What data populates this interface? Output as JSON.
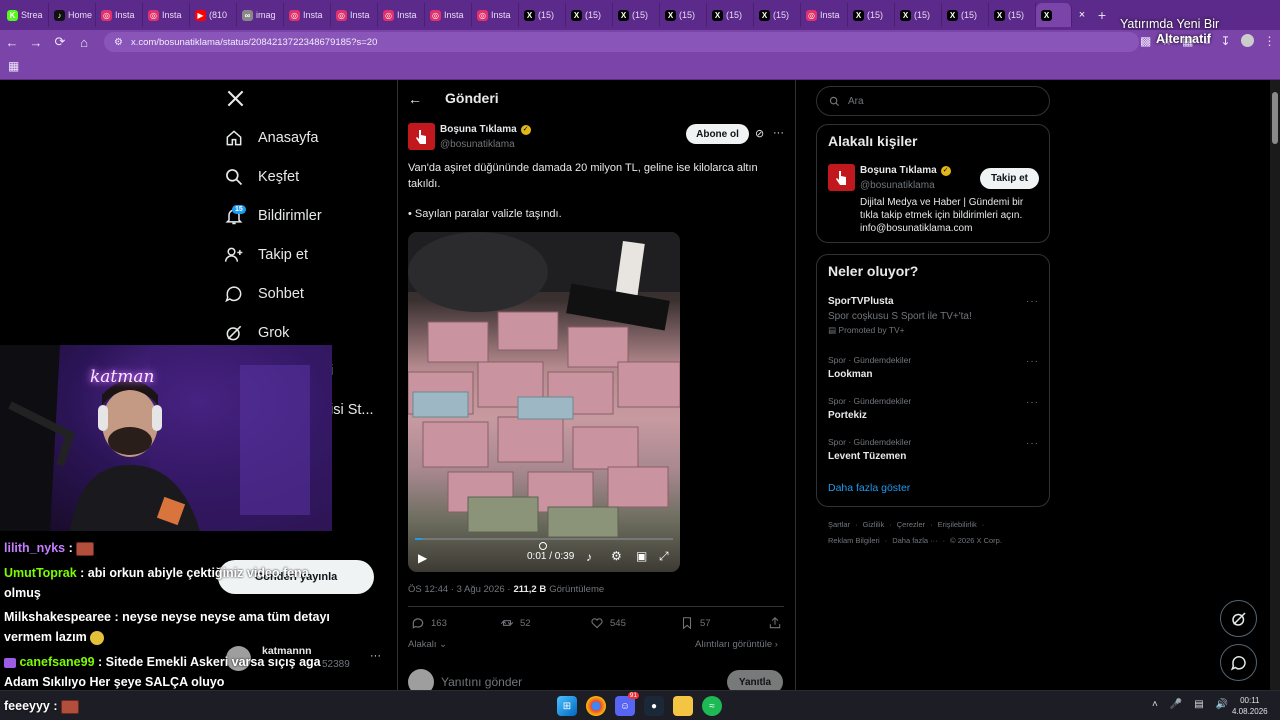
{
  "browser": {
    "tabs": [
      {
        "label": "Strea",
        "icon": "kick-icon",
        "color": "#53fc18"
      },
      {
        "label": "Home",
        "icon": "tiktok-icon",
        "color": "#111111"
      },
      {
        "label": "Insta",
        "icon": "instagram-icon",
        "color": "#e1306c"
      },
      {
        "label": "Insta",
        "icon": "instagram-icon",
        "color": "#e1306c"
      },
      {
        "label": "(810",
        "icon": "youtube-icon",
        "color": "#ff0000"
      },
      {
        "label": "imag",
        "icon": "link-icon",
        "color": "#888888"
      },
      {
        "label": "Insta",
        "icon": "instagram-icon",
        "color": "#e1306c"
      },
      {
        "label": "Insta",
        "icon": "instagram-icon",
        "color": "#e1306c"
      },
      {
        "label": "Insta",
        "icon": "instagram-icon",
        "color": "#e1306c"
      },
      {
        "label": "Insta",
        "icon": "instagram-icon",
        "color": "#e1306c"
      },
      {
        "label": "Insta",
        "icon": "instagram-icon",
        "color": "#e1306c"
      },
      {
        "label": "(15)",
        "icon": "x-icon",
        "color": "#000000"
      },
      {
        "label": "(15)",
        "icon": "x-icon",
        "color": "#000000"
      },
      {
        "label": "(15)",
        "icon": "x-icon",
        "color": "#000000"
      },
      {
        "label": "(15)",
        "icon": "x-icon",
        "color": "#000000"
      },
      {
        "label": "(15)",
        "icon": "x-icon",
        "color": "#000000"
      },
      {
        "label": "(15)",
        "icon": "x-icon",
        "color": "#000000"
      },
      {
        "label": "Insta",
        "icon": "instagram-icon",
        "color": "#e1306c"
      },
      {
        "label": "(15)",
        "icon": "x-icon",
        "color": "#000000"
      },
      {
        "label": "(15)",
        "icon": "x-icon",
        "color": "#000000"
      },
      {
        "label": "(15)",
        "icon": "x-icon",
        "color": "#000000"
      },
      {
        "label": "(15)",
        "icon": "x-icon",
        "color": "#000000"
      }
    ],
    "active_tab_label": "",
    "url": "x.com/bosunatiklama/status/2084213722348679185?s=20"
  },
  "overlay": {
    "notification_line1": "Yatırımda Yeni Bir",
    "notification_line2": "Alternatif"
  },
  "nav": {
    "items": [
      {
        "label": "Anasayfa",
        "icon": "home-icon"
      },
      {
        "label": "Keşfet",
        "icon": "search-icon"
      },
      {
        "label": "Bildirimler",
        "icon": "bell-icon"
      },
      {
        "label": "Takip et",
        "icon": "add-user-icon"
      },
      {
        "label": "Sohbet",
        "icon": "chat-icon"
      },
      {
        "label": "Grok",
        "icon": "grok-icon"
      }
    ],
    "badge": "15",
    "partial_item": "isi St...",
    "post_button": "Gönderi yayınla",
    "account_name": "katmannn",
    "account_handle": "52389"
  },
  "header": {
    "title": "Gönderi"
  },
  "post": {
    "author": "Boşuna Tıklama",
    "handle": "@bosunatiklama",
    "follow_label": "Abone ol",
    "text1": "Van'da aşiret düğününde damada 20 milyon TL, geline ise kilolarca altın takıldı.",
    "text2": "• Sayılan paralar valizle taşındı.",
    "video_time": "0:01 / 0:39",
    "video_progress": 0.026,
    "timestamp": "ÖS 12:44 · 3 Ağu 2026 ·",
    "views": "211,2 B",
    "views_label": "Görüntüleme",
    "replies": "163",
    "reposts": "52",
    "likes": "545",
    "bookmarks": "57",
    "relevant_label": "Alakalı",
    "quotes_label": "Alıntıları görüntüle",
    "reply_placeholder": "Yanıtını gönder",
    "reply_button": "Yanıtla"
  },
  "right": {
    "search_placeholder": "Ara",
    "relevant_people": {
      "title": "Alakalı kişiler",
      "name": "Boşuna Tıklama",
      "handle": "@bosunatiklama",
      "follow_label": "Takip et",
      "bio_line1": "Dijital Medya ve Haber | Gündemi bir",
      "bio_line2": "tıkla takip etmek için bildirimleri açın.",
      "bio_line3": "info@bosunatiklama.com"
    },
    "trends": {
      "title": "Neler oluyor?",
      "items": [
        {
          "context": "",
          "name": "SporTVPlusta",
          "desc": "Spor coşkusu S Sport ile TV+'ta!",
          "promo": "Promoted by TV+"
        },
        {
          "context": "Spor · Gündemdekiler",
          "name": "Lookman"
        },
        {
          "context": "Spor · Gündemdekiler",
          "name": "Portekiz"
        },
        {
          "context": "Spor · Gündemdekiler",
          "name": "Levent Tüzemen"
        }
      ],
      "show_more": "Daha fazla göster"
    },
    "footer_line1": [
      "Şartlar",
      "Gizlilik",
      "Çerezler",
      "Erişilebilirlik"
    ],
    "footer_line2": [
      "Reklam Bilgileri",
      "Daha fazla ···",
      "© 2026 X Corp."
    ]
  },
  "stream": {
    "overlay_label": "katman",
    "chat": [
      {
        "user": "lilith_nyks",
        "text": "",
        "color": "#c77dff"
      },
      {
        "user": "UmutToprak",
        "text": "abi orkun abiyle çektiğiniz video fena",
        "text2": "olmuş",
        "color": "#7CFC00"
      },
      {
        "user": "Milkshakespearee",
        "text": "neyse neyse neyse ama tüm detayı",
        "text2": "vermem lazım",
        "color": "#ffffff"
      },
      {
        "user": "canefsane99",
        "text": "Sitede Emekli Askeri varsa sıçış aga",
        "text2": "Adam Sıkılıyo Her şeye SALÇA oluyo",
        "color": "#7CFC00"
      },
      {
        "user": "feeeyyy",
        "text": "",
        "color": "#ffffff"
      }
    ]
  },
  "taskbar": {
    "time": "00:11",
    "date": "4.08.2026",
    "discord_badge": "91"
  }
}
